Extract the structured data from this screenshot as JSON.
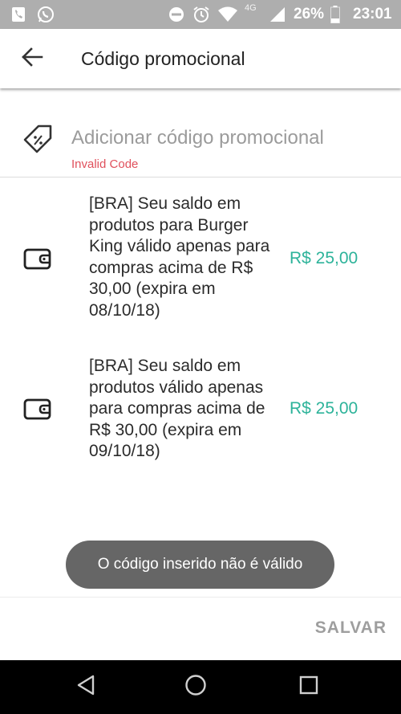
{
  "status_bar": {
    "network": "4G",
    "battery": "26%",
    "time": "23:01",
    "icons": [
      "phone-app-icon",
      "whatsapp-icon",
      "dnd-icon",
      "alarm-icon",
      "wifi-icon",
      "signal-icon",
      "battery-icon"
    ]
  },
  "app_bar": {
    "title": "Código promocional",
    "back_icon": "arrow-left-icon"
  },
  "promo": {
    "placeholder": "Adicionar código promocional",
    "value": "",
    "error": "Invalid Code",
    "icon": "discount-tag-icon"
  },
  "credits": [
    {
      "description": "[BRA] Seu saldo em produtos para Burger King válido apenas para compras acima de R$ 30,00 (expira em 08/10/18)",
      "amount": "R$ 25,00",
      "icon": "wallet-icon"
    },
    {
      "description": "[BRA] Seu saldo em produtos válido apenas para compras acima de R$ 30,00 (expira em 09/10/18)",
      "amount": "R$ 25,00",
      "icon": "wallet-icon"
    }
  ],
  "toast": {
    "message": "O código inserido não é válido"
  },
  "actions": {
    "save_label": "SALVAR"
  },
  "nav_bar": {
    "icons": [
      "back-triangle-icon",
      "home-circle-icon",
      "recents-square-icon"
    ]
  },
  "colors": {
    "accent_green": "#2db39a",
    "error_red": "#e0505c",
    "status_bar_bg": "#aeaeae",
    "toast_bg": "#666666",
    "disabled_text": "#9e9e9e"
  }
}
